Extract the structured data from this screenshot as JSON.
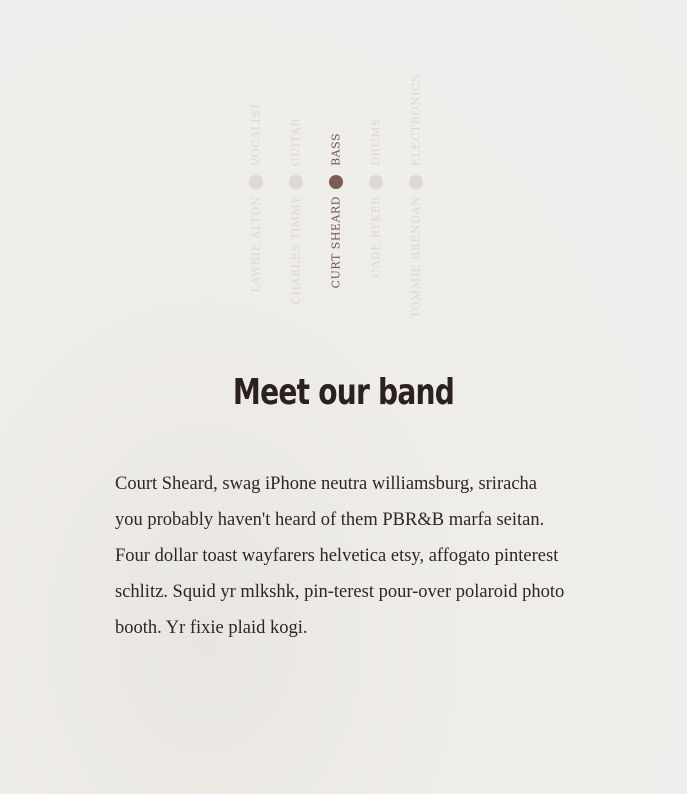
{
  "band": {
    "members": [
      {
        "name": "LAWRIE ALTON",
        "role": "VOCALIST",
        "active": false
      },
      {
        "name": "CHARLES TIMMY",
        "role": "GUITAR",
        "active": false
      },
      {
        "name": "CURT SHEARD",
        "role": "BASS",
        "active": true
      },
      {
        "name": "CADE RYKER",
        "role": "DRUMS",
        "active": false
      },
      {
        "name": "TOMMIE BRENDAN",
        "role": "ELECTRONICS",
        "active": false
      }
    ],
    "title": "Meet our band",
    "bio": "Court Sheard, swag iPhone neutra williamsburg, sriracha you probably haven't heard of them PBR&B marfa seitan. Four dollar toast wayfarers helvetica etsy, affogato pinterest schlitz. Squid yr mlkshk, pin-terest pour-over polaroid photo booth. Yr fixie plaid kogi."
  }
}
